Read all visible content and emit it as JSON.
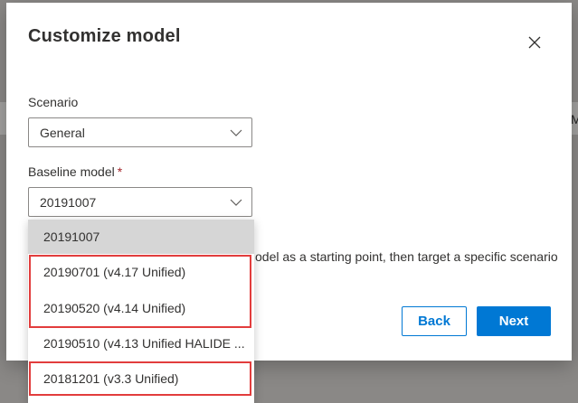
{
  "backdrop": {
    "edge_text": "M"
  },
  "dialog": {
    "title": "Customize model",
    "close_icon": "close-icon",
    "scenario": {
      "label": "Scenario",
      "value": "General"
    },
    "baseline": {
      "label": "Baseline model",
      "required_mark": "*",
      "value": "20191007",
      "options": [
        "20191007",
        "20190701 (v4.17 Unified)",
        "20190520 (v4.14 Unified)",
        "20190510 (v4.13 Unified HALIDE ...",
        "20181201 (v3.3 Unified)"
      ]
    },
    "description": "odel as a starting point, then target a specific scenario",
    "buttons": {
      "back": "Back",
      "next": "Next"
    }
  },
  "colors": {
    "accent": "#0078d4",
    "highlight": "#e23d3d",
    "required": "#a4262c",
    "overlay": "#8a8886"
  }
}
